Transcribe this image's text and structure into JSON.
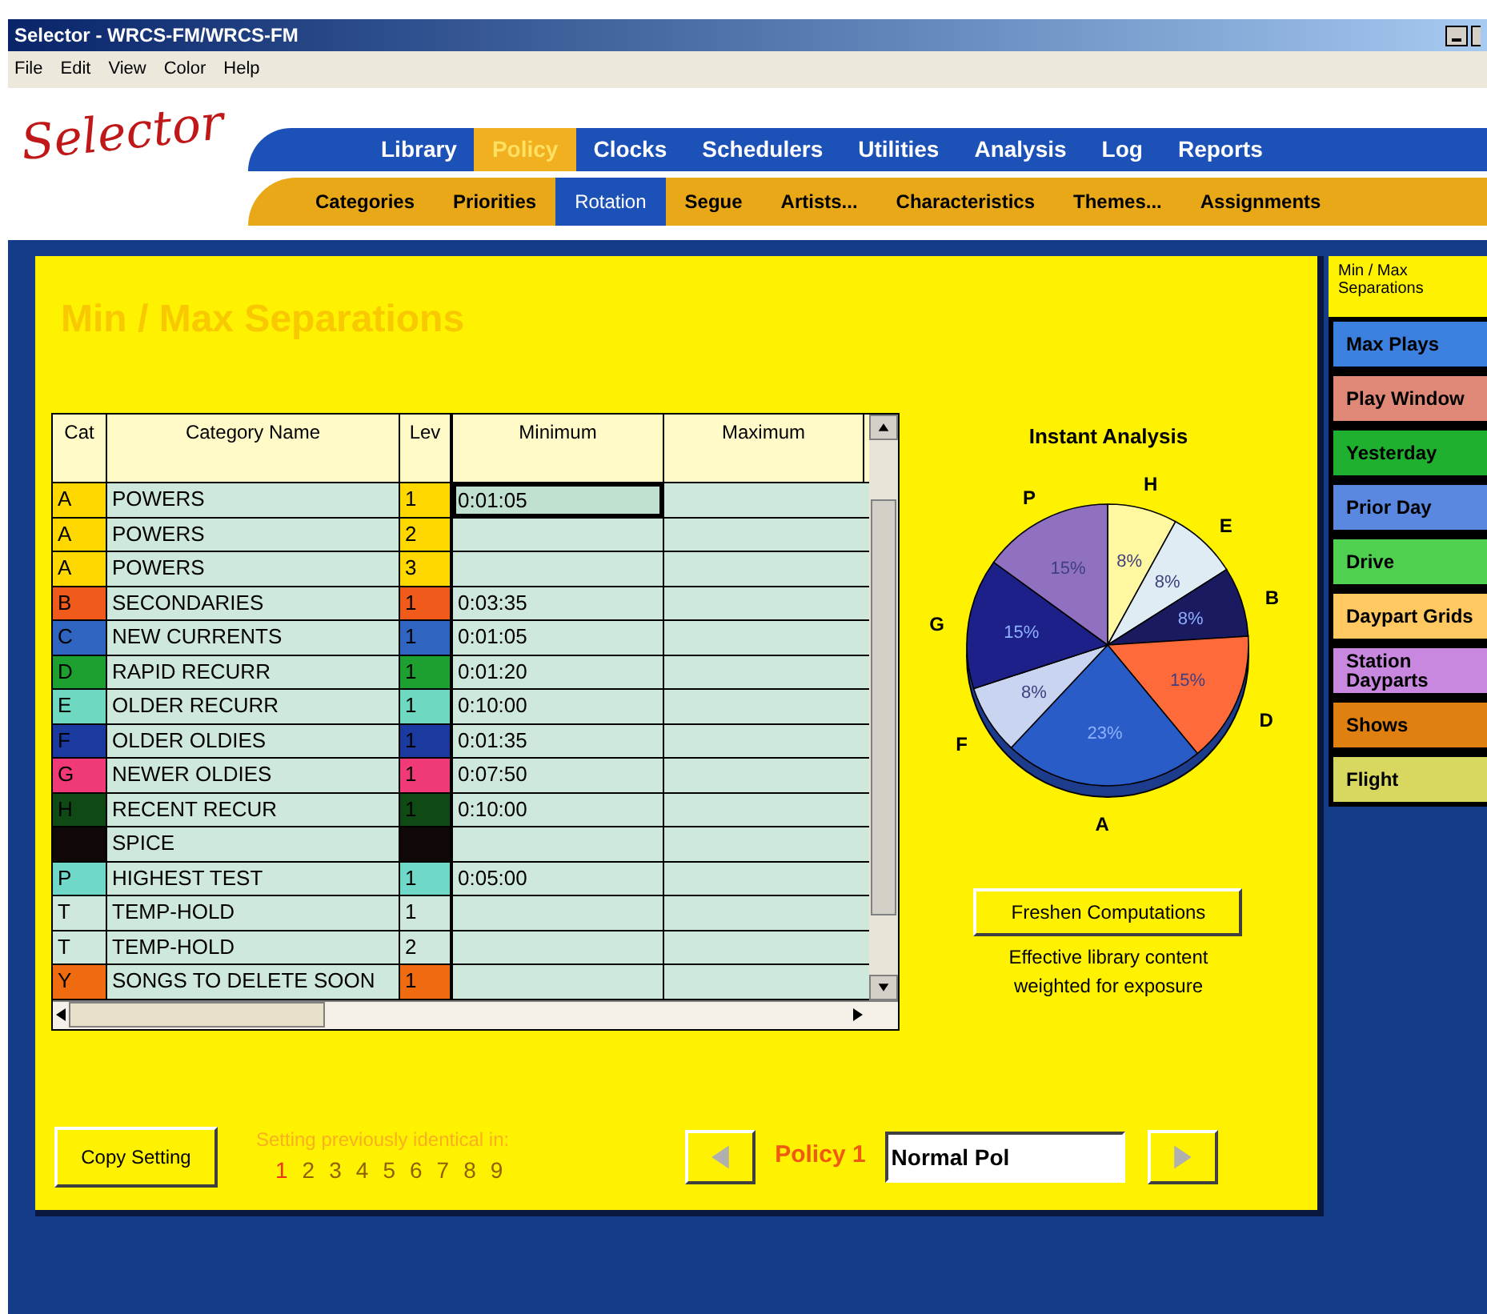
{
  "window": {
    "title": "Selector - WRCS-FM/WRCS-FM"
  },
  "menu": [
    "File",
    "Edit",
    "View",
    "Color",
    "Help"
  ],
  "logo": "Selector",
  "tabs": [
    {
      "label": "Library",
      "selected": false
    },
    {
      "label": "Policy",
      "selected": true
    },
    {
      "label": "Clocks",
      "selected": false
    },
    {
      "label": "Schedulers",
      "selected": false
    },
    {
      "label": "Utilities",
      "selected": false
    },
    {
      "label": "Analysis",
      "selected": false
    },
    {
      "label": "Log",
      "selected": false
    },
    {
      "label": "Reports",
      "selected": false
    }
  ],
  "subtabs": [
    {
      "label": "Categories",
      "selected": false
    },
    {
      "label": "Priorities",
      "selected": false
    },
    {
      "label": "Rotation",
      "selected": true
    },
    {
      "label": "Segue",
      "selected": false
    },
    {
      "label": "Artists...",
      "selected": false
    },
    {
      "label": "Characteristics",
      "selected": false
    },
    {
      "label": "Themes...",
      "selected": false
    },
    {
      "label": "Assignments",
      "selected": false
    }
  ],
  "page_title": "Min / Max Separations",
  "table": {
    "columns": [
      "Cat",
      "Category Name",
      "Lev",
      "Minimum",
      "Maximum"
    ],
    "rows": [
      {
        "cat": "A",
        "name": "POWERS",
        "lev": "1",
        "minimum": "0:01:05",
        "color": "#ffd800",
        "selected": true
      },
      {
        "cat": "A",
        "name": "POWERS",
        "lev": "2",
        "color": "#ffd800",
        "selected": false
      },
      {
        "cat": "A",
        "name": "POWERS",
        "lev": "3",
        "color": "#ffd800",
        "selected": false
      },
      {
        "cat": "B",
        "name": "SECONDARIES",
        "lev": "1",
        "minimum": "0:03:35",
        "color": "#f05a1a",
        "selected": false
      },
      {
        "cat": "C",
        "name": "NEW CURRENTS",
        "lev": "1",
        "minimum": "0:01:05",
        "color": "#2f64c0",
        "selected": false
      },
      {
        "cat": "D",
        "name": "RAPID RECURR",
        "lev": "1",
        "minimum": "0:01:20",
        "color": "#1ea030",
        "selected": false
      },
      {
        "cat": "E",
        "name": "OLDER RECURR",
        "lev": "1",
        "minimum": "0:10:00",
        "color": "#6fd8c0",
        "selected": false
      },
      {
        "cat": "F",
        "name": "OLDER OLDIES",
        "lev": "1",
        "minimum": "0:01:35",
        "color": "#1a3aa0",
        "selected": false
      },
      {
        "cat": "G",
        "name": "NEWER OLDIES",
        "lev": "1",
        "minimum": "0:07:50",
        "color": "#f03a78",
        "selected": false
      },
      {
        "cat": "H",
        "name": "RECENT RECUR",
        "lev": "1",
        "minimum": "0:10:00",
        "color": "#0f4a14",
        "selected": false
      },
      {
        "name": "SPICE",
        "color": "#100808",
        "selected": false
      },
      {
        "cat": "P",
        "name": "HIGHEST TEST",
        "lev": "1",
        "minimum": "0:05:00",
        "color": "#70d8c8",
        "selected": false
      },
      {
        "cat": "T",
        "name": "TEMP-HOLD",
        "lev": "1",
        "selected": false
      },
      {
        "cat": "T",
        "name": "TEMP-HOLD",
        "lev": "2",
        "selected": false
      },
      {
        "cat": "Y",
        "name": "SONGS TO DELETE SOON",
        "lev": "1",
        "color": "#f06a10",
        "selected": false
      }
    ]
  },
  "analysis": {
    "title": "Instant Analysis",
    "chart_data": {
      "type": "pie",
      "categories": [
        "H",
        "E",
        "B",
        "D",
        "A",
        "F",
        "G",
        "P"
      ],
      "values": [
        8,
        8,
        8,
        15,
        23,
        8,
        15,
        15
      ],
      "value_labels": [
        "8%",
        "8%",
        "8%",
        "15%",
        "23%",
        "8%",
        "15%",
        "15%"
      ],
      "colors": [
        "#fff8a0",
        "#e0ecf4",
        "#1a1a60",
        "#ff6a3a",
        "#2a5cc8",
        "#c8d4f0",
        "#1c2088",
        "#9070c0"
      ]
    },
    "button": "Freshen Computations",
    "caption": "Effective library content weighted for exposure"
  },
  "side_tabs": [
    {
      "label": "Min / Max Separations",
      "selected": true
    },
    {
      "label": "Max Plays",
      "color": "#3c80e0",
      "selected": false
    },
    {
      "label": "Play Window",
      "color": "#e08878",
      "selected": false
    },
    {
      "label": "Yesterday",
      "color": "#20b030",
      "selected": false
    },
    {
      "label": "Prior Day",
      "color": "#5a88e0",
      "selected": false
    },
    {
      "label": "Drive",
      "color": "#50d050",
      "selected": false
    },
    {
      "label": "Daypart Grids",
      "color": "#ffc860",
      "selected": false
    },
    {
      "label": "Station Dayparts",
      "color": "#c888e0",
      "selected": false
    },
    {
      "label": "Shows",
      "color": "#e08010",
      "selected": false
    },
    {
      "label": "Flight",
      "color": "#d8d860",
      "selected": false
    }
  ],
  "footer": {
    "copy_button": "Copy Setting",
    "identical_label": "Setting previously identical in:",
    "levels": [
      {
        "label": "1",
        "selected": true
      },
      {
        "label": "2",
        "selected": false
      },
      {
        "label": "3",
        "selected": false
      },
      {
        "label": "4",
        "selected": false
      },
      {
        "label": "5",
        "selected": false
      },
      {
        "label": "6",
        "selected": false
      },
      {
        "label": "7",
        "selected": false
      },
      {
        "label": "8",
        "selected": false
      },
      {
        "label": "9",
        "selected": false
      }
    ],
    "policy_label": "Policy 1",
    "policy_name": "Normal Pol"
  }
}
